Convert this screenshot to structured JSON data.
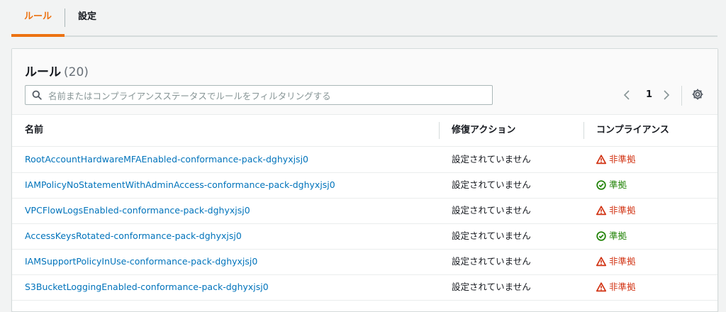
{
  "tabs": [
    {
      "label": "ルール"
    },
    {
      "label": "設定"
    }
  ],
  "panel": {
    "title": "ルール",
    "count": "(20)"
  },
  "search": {
    "placeholder": "名前またはコンプライアンスステータスでルールをフィルタリングする",
    "value": ""
  },
  "pagination": {
    "current_page": "1"
  },
  "table": {
    "headers": [
      "名前",
      "修復アクション",
      "コンプライアンス"
    ],
    "rows": [
      {
        "name": "RootAccountHardwareMFAEnabled-conformance-pack-dghyxjsj0",
        "remediation": "設定されていません",
        "compliance": "非準拠",
        "status": "noncompliant"
      },
      {
        "name": "IAMPolicyNoStatementWithAdminAccess-conformance-pack-dghyxjsj0",
        "remediation": "設定されていません",
        "compliance": "準拠",
        "status": "compliant"
      },
      {
        "name": "VPCFlowLogsEnabled-conformance-pack-dghyxjsj0",
        "remediation": "設定されていません",
        "compliance": "非準拠",
        "status": "noncompliant"
      },
      {
        "name": "AccessKeysRotated-conformance-pack-dghyxjsj0",
        "remediation": "設定されていません",
        "compliance": "準拠",
        "status": "compliant"
      },
      {
        "name": "IAMSupportPolicyInUse-conformance-pack-dghyxjsj0",
        "remediation": "設定されていません",
        "compliance": "非準拠",
        "status": "noncompliant"
      },
      {
        "name": "S3BucketLoggingEnabled-conformance-pack-dghyxjsj0",
        "remediation": "設定されていません",
        "compliance": "非準拠",
        "status": "noncompliant"
      }
    ]
  },
  "colors": {
    "accent": "#ec7211",
    "link": "#0073bb",
    "noncompliant": "#d13212",
    "compliant": "#1d8102"
  },
  "icons": {
    "search": "search-icon",
    "prev": "chevron-left-icon",
    "next": "chevron-right-icon",
    "settings": "gear-icon",
    "noncompliant": "warning-icon",
    "compliant": "check-circle-icon"
  }
}
